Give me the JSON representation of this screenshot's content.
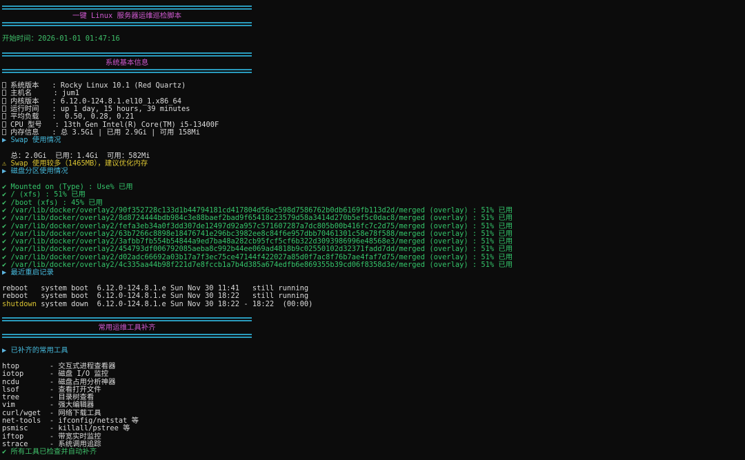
{
  "banner_title": "一键 Linux 服务器运维巡检脚本",
  "start_time": "开始时间：2026-01-01 01:47:16",
  "section_basic": "系统基本信息",
  "basic_info": [
    {
      "label": "系统版本   ",
      "value": "Rocky Linux 10.1 (Red Quartz)"
    },
    {
      "label": "主机名     ",
      "value": "jum1"
    },
    {
      "label": "内核版本   ",
      "value": "6.12.0-124.8.1.el10_1.x86_64"
    },
    {
      "label": "运行时间   ",
      "value": "up 1 day, 15 hours, 39 minutes"
    },
    {
      "label": "平均负载   ",
      "value": " 0.50, 0.28, 0.21"
    },
    {
      "label": "CPU 型号   ",
      "value": "13th Gen Intel(R) Core(TM) i5-13400F"
    },
    {
      "label": "内存信息   ",
      "value": "总 3.5Gi | 已用 2.9Gi | 可用 158Mi"
    }
  ],
  "swap_header": "Swap 使用情况",
  "swap_line": "  总：2.0Gi  已用：1.4Gi  可用：582Mi",
  "swap_warn": "Swap 使用较多（1465MB），建议优化内存",
  "disk_header": "磁盘分区使用情况",
  "disk_lines": [
    "Mounted on (Type) : Use% 已用",
    "/ (xfs) : 51% 已用",
    "/boot (xfs) : 45% 已用",
    "/var/lib/docker/overlay2/90f352728c133d1b44794181cd417804d56ac598d7586762b0db6169fb113d2d/merged (overlay) : 51% 已用",
    "/var/lib/docker/overlay2/8d8724444bdb984c3e88baef2bad9f65418c23579d58a3414d270b5ef5c0dac8/merged (overlay) : 51% 已用",
    "/var/lib/docker/overlay2/fefa3eb34a0f3dd307de12497d92a957c571607287a7dc805b00b416fc7c2d75/merged (overlay) : 51% 已用",
    "/var/lib/docker/overlay2/63b7266c8898e18476741e296bc3982ee8c84f6e957dbb70461301c58e78f588/merged (overlay) : 51% 已用",
    "/var/lib/docker/overlay2/3afbb7fb554b54844a9ed7ba48a282cb95fcf5cf6b322d3093986996e48568e3/merged (overlay) : 51% 已用",
    "/var/lib/docker/overlay2/454793df006792085aeba8c992b44ee069ad4818b9c02550102d32371fadd7dd/merged (overlay) : 51% 已用",
    "/var/lib/docker/overlay2/d02adc66692a03b17a7f3ec75ce47144f422027a85d0f7ac8f76b7ae4faf7d75/merged (overlay) : 51% 已用",
    "/var/lib/docker/overlay2/4c335aa44b98f221d7e8fccb1a7b4d385a674edfb6e869355b39cd06f8358d3e/merged (overlay) : 51% 已用"
  ],
  "reboot_header": "最近重启记录",
  "reboot_lines": [
    {
      "cmd": "reboot  ",
      "rest": " system boot  6.12.0-124.8.1.e Sun Nov 30 11:41   still running"
    },
    {
      "cmd": "reboot  ",
      "rest": " system boot  6.12.0-124.8.1.e Sun Nov 30 18:22   still running"
    },
    {
      "cmd": "shutdown",
      "rest": " system down  6.12.0-124.8.1.e Sun Nov 30 18:22 - 18:22  (00:00)"
    }
  ],
  "section_tools": "常用运维工具补齐",
  "tools_header": "已补齐的常用工具",
  "tools": [
    {
      "name": "htop      ",
      "desc": " - 交互式进程查看器"
    },
    {
      "name": "iotop     ",
      "desc": " - 磁盘 I/O 监控"
    },
    {
      "name": "ncdu      ",
      "desc": " - 磁盘占用分析神器"
    },
    {
      "name": "lsof      ",
      "desc": " - 查看打开文件"
    },
    {
      "name": "tree      ",
      "desc": " - 目录树查看"
    },
    {
      "name": "vim       ",
      "desc": " - 强大编辑器"
    },
    {
      "name": "curl/wget ",
      "desc": " - 网络下载工具"
    },
    {
      "name": "net-tools ",
      "desc": " - ifconfig/netstat 等"
    },
    {
      "name": "psmisc    ",
      "desc": " - killall/pstree 等"
    },
    {
      "name": "iftop     ",
      "desc": " - 带宽实时监控"
    },
    {
      "name": "strace    ",
      "desc": " - 系统调用追踪"
    }
  ],
  "tools_done": "所有工具已检查并自动补齐"
}
